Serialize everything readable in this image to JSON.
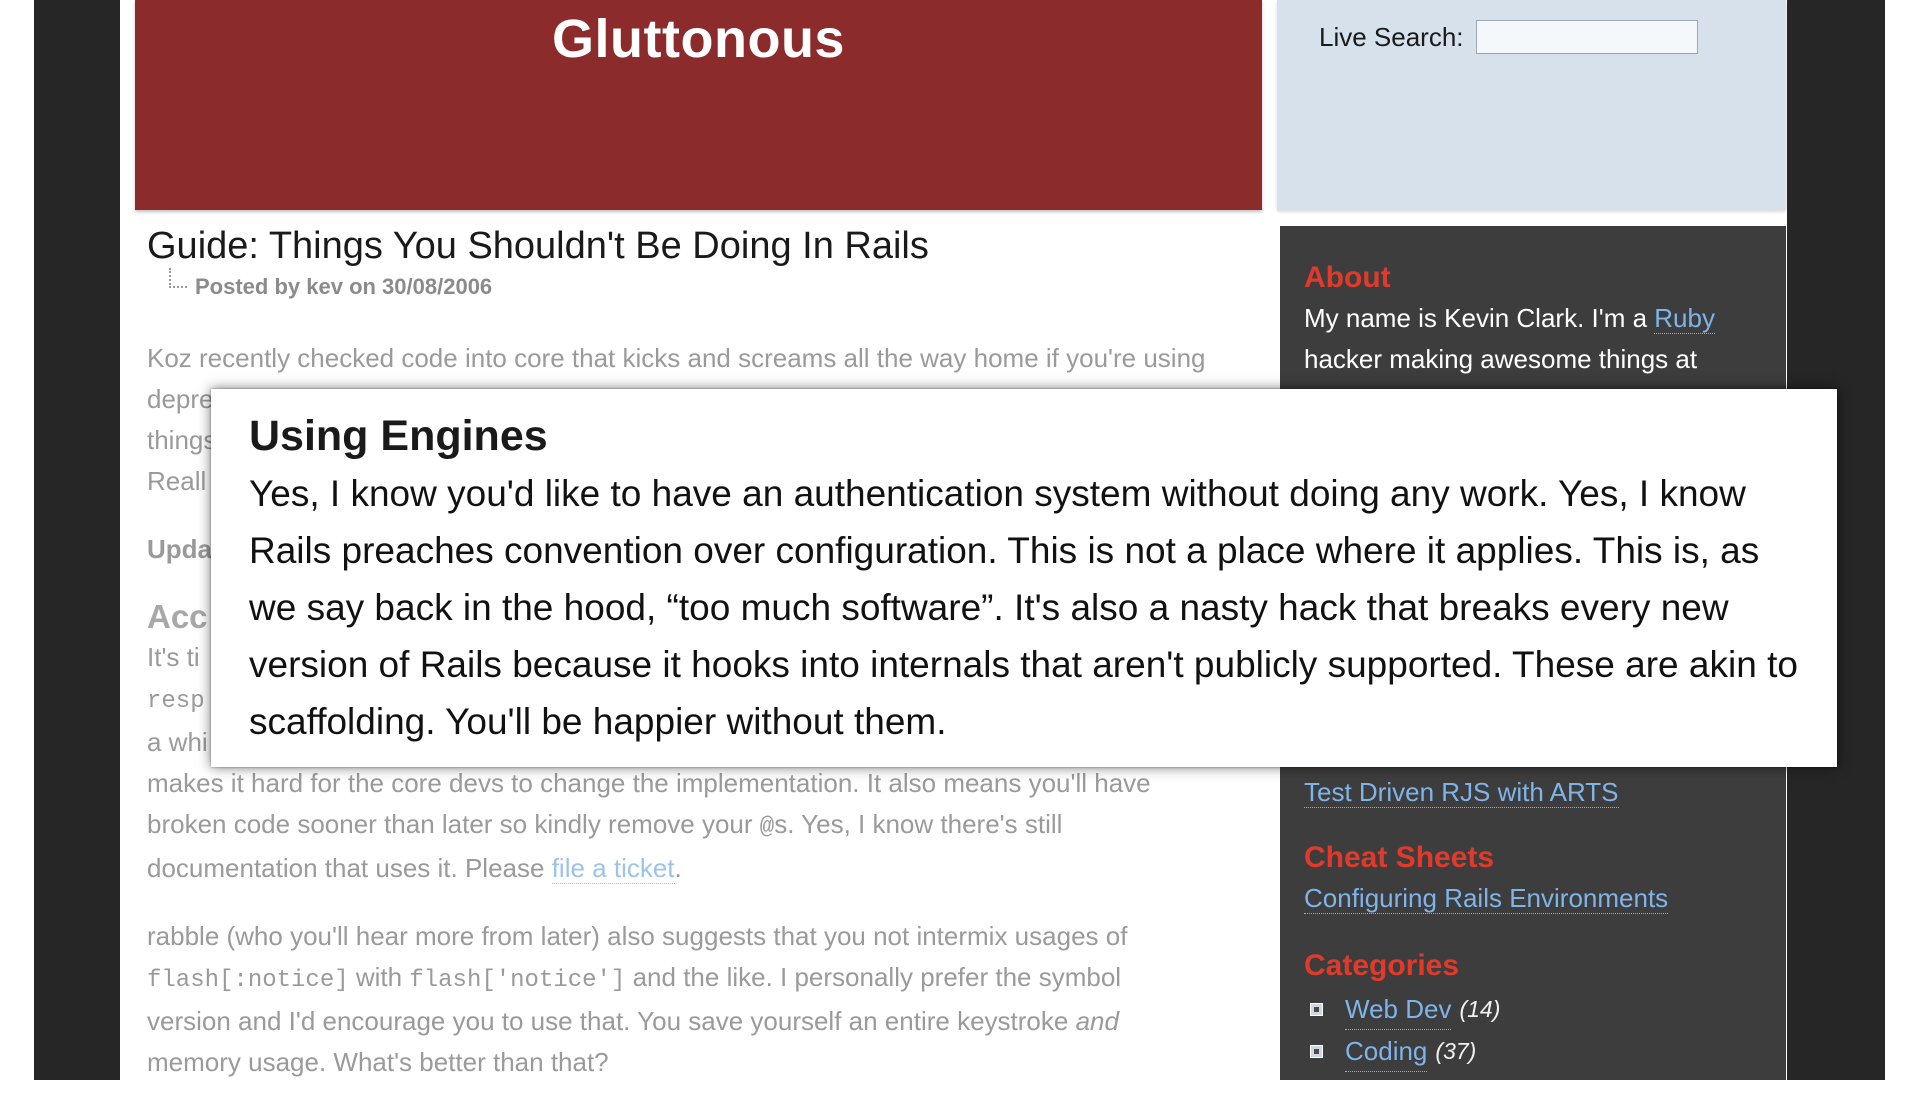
{
  "header": {
    "title": "Gluttonous"
  },
  "search": {
    "label": "Live Search:",
    "placeholder": "",
    "value": ""
  },
  "post": {
    "title": "Guide: Things You Shouldn't Be Doing In Rails",
    "meta": "Posted by kev on 30/08/2006",
    "para1_line1": "Koz recently checked code into core that kicks and screams all the way home if you're using",
    "para1_line2": "depre",
    "para1_line3": "things",
    "para1_line4": "Reall",
    "update_fragment": "Upda",
    "section_heading_fragment": "Acc",
    "para3_line1": "It's ti",
    "para3_line2_code": "resp",
    "para3_line3": "a whi",
    "para3_line4": "makes it hard for the core devs to change the implementation. It also means you'll have",
    "para3_line5": "broken code sooner than later so kindly remove your ",
    "para3_line5_code": "@",
    "para3_line5_end": "s. Yes, I know there's still",
    "para3_line6_start": "documentation that uses it. Please ",
    "para3_link": "file a ticket",
    "para3_line6_end": ".",
    "para4_line1": "rabble (who you'll hear more from later) also suggests that you not intermix usages of",
    "para4_code1": "flash[:notice]",
    "para4_mid": " with ",
    "para4_code2": "flash['notice']",
    "para4_line2_end": " and the like. I personally prefer the symbol",
    "para4_line3_start": "version and I'd encourage you to use that. You save yourself an entire keystroke ",
    "para4_line3_em": "and",
    "para4_line4": "memory usage. What's better than that?"
  },
  "sidebar": {
    "about_heading": "About",
    "about_text_start": "My name is Kevin Clark. I'm a ",
    "about_link": "Ruby",
    "about_text_2": "hacker making awesome things at",
    "partial_link": "Test Driven RJS with ARTS",
    "cheat_heading": "Cheat Sheets",
    "cheat_link": "Configuring Rails Environments",
    "categories_heading": "Categories",
    "categories": [
      {
        "label": "Web Dev",
        "count": "(14)"
      },
      {
        "label": "Coding",
        "count": "(37)"
      }
    ]
  },
  "popup": {
    "title": "Using Engines",
    "text": "Yes, I know you'd like to have an authentication system without doing any work. Yes, I know Rails preaches convention over configuration. This is not a place where it applies. This is, as we say back in the hood, “too much software”. It's also a nasty hack that breaks every new version of Rails because it hooks into internals that aren't publicly supported. These are akin to scaffolding. You'll be happier without them."
  }
}
